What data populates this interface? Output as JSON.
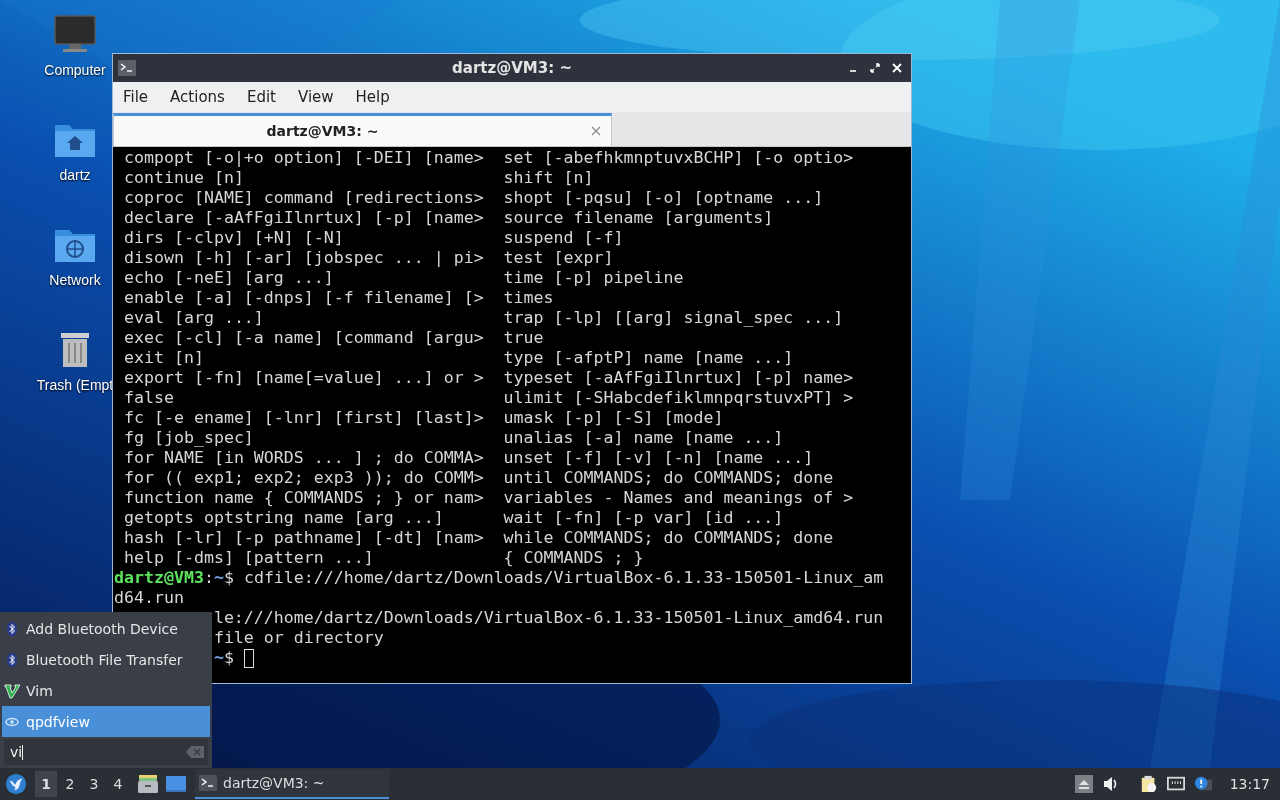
{
  "desktop_icons": [
    {
      "label": "Computer",
      "kind": "computer"
    },
    {
      "label": "dartz",
      "kind": "home"
    },
    {
      "label": "Network",
      "kind": "network"
    },
    {
      "label": "Trash (Empt",
      "kind": "trash"
    }
  ],
  "terminal": {
    "title": "dartz@VM3: ~",
    "menu": [
      "File",
      "Actions",
      "Edit",
      "View",
      "Help"
    ],
    "tabs": [
      {
        "label": "dartz@VM3: ~",
        "selected": true
      }
    ],
    "rows": [
      {
        "left": "compopt [-o|+o option] [-DEI] [name>",
        "right": "set [-abefhkmnptuvxBCHP] [-o optio>"
      },
      {
        "left": "continue [n]",
        "right": "shift [n]"
      },
      {
        "left": "coproc [NAME] command [redirections>",
        "right": "shopt [-pqsu] [-o] [optname ...]"
      },
      {
        "left": "declare [-aAfFgiIlnrtux] [-p] [name>",
        "right": "source filename [arguments]"
      },
      {
        "left": "dirs [-clpv] [+N] [-N]",
        "right": "suspend [-f]"
      },
      {
        "left": "disown [-h] [-ar] [jobspec ... | pi>",
        "right": "test [expr]"
      },
      {
        "left": "echo [-neE] [arg ...]",
        "right": "time [-p] pipeline"
      },
      {
        "left": "enable [-a] [-dnps] [-f filename] [>",
        "right": "times"
      },
      {
        "left": "eval [arg ...]",
        "right": "trap [-lp] [[arg] signal_spec ...]"
      },
      {
        "left": "exec [-cl] [-a name] [command [argu>",
        "right": "true"
      },
      {
        "left": "exit [n]",
        "right": "type [-afptP] name [name ...]"
      },
      {
        "left": "export [-fn] [name[=value] ...] or >",
        "right": "typeset [-aAfFgiIlnrtux] [-p] name>"
      },
      {
        "left": "false",
        "right": "ulimit [-SHabcdefiklmnpqrstuvxPT] >"
      },
      {
        "left": "fc [-e ename] [-lnr] [first] [last]>",
        "right": "umask [-p] [-S] [mode]"
      },
      {
        "left": "fg [job_spec]",
        "right": "unalias [-a] name [name ...]"
      },
      {
        "left": "for NAME [in WORDS ... ] ; do COMMA>",
        "right": "unset [-f] [-v] [-n] [name ...]"
      },
      {
        "left": "for (( exp1; exp2; exp3 )); do COMM>",
        "right": "until COMMANDS; do COMMANDS; done"
      },
      {
        "left": "function name { COMMANDS ; } or nam>",
        "right": "variables - Names and meanings of >"
      },
      {
        "left": "getopts optstring name [arg ...]",
        "right": "wait [-fn] [-p var] [id ...]"
      },
      {
        "left": "hash [-lr] [-p pathname] [-dt] [nam>",
        "right": "while COMMANDS; do COMMANDS; done"
      },
      {
        "left": "help [-dms] [pattern ...]",
        "right": "{ COMMANDS ; }"
      }
    ],
    "lines": [
      {
        "kind": "prompt",
        "user": "dartz@VM3",
        "sep": ":",
        "path": "~",
        "text": "$ cdfile:///home/dartz/Downloads/VirtualBox-6.1.33-150501-Linux_am"
      },
      {
        "kind": "plain",
        "text": "d64.run"
      },
      {
        "kind": "partial",
        "text": "le:///home/dartz/Downloads/VirtualBox-6.1.33-150501-Linux_amd64.run"
      },
      {
        "kind": "partial",
        "text": "file or directory"
      },
      {
        "kind": "partial_prompt",
        "path": "~",
        "text": "$"
      }
    ]
  },
  "launcher": {
    "items": [
      {
        "label": "Add Bluetooth Device",
        "kind": "bluetooth",
        "selected": false
      },
      {
        "label": "Bluetooth File Transfer",
        "kind": "bluetooth",
        "selected": false
      },
      {
        "label": "Vim",
        "kind": "vim",
        "selected": false
      },
      {
        "label": "qpdfview",
        "kind": "eye",
        "selected": true
      }
    ],
    "search": {
      "value": "vi"
    }
  },
  "taskbar": {
    "workspaces": [
      {
        "label": "1",
        "selected": true
      },
      {
        "label": "2",
        "selected": false
      },
      {
        "label": "3",
        "selected": false
      },
      {
        "label": "4",
        "selected": false
      }
    ],
    "tasks": [
      {
        "label": "dartz@VM3: ~",
        "selected": true
      }
    ],
    "clock": "13:17"
  }
}
